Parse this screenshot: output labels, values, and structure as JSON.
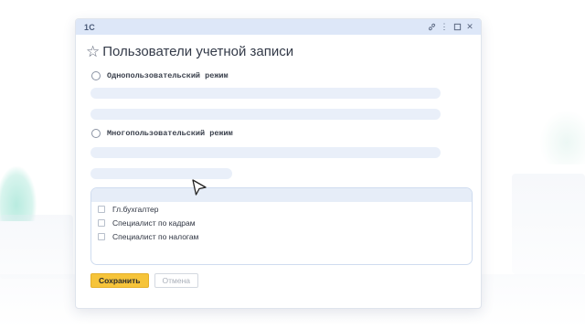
{
  "window": {
    "app_label": "1С",
    "title": "Пользователи учетной записи",
    "titlebar_icons": [
      "link-icon",
      "more-icon",
      "maximize-icon",
      "close-icon"
    ],
    "titlebar_glyphs": {
      "more": "⋮",
      "close": "✕"
    }
  },
  "icons": {
    "star": "☆"
  },
  "options": [
    {
      "label": "Однопользовательский режим",
      "selected": false
    },
    {
      "label": "Многопользовательский режим",
      "selected": false
    }
  ],
  "user_list": {
    "items": [
      {
        "label": "Гл.бухгалтер",
        "checked": false
      },
      {
        "label": "Специалист по кадрам",
        "checked": false
      },
      {
        "label": "Специалист по налогам",
        "checked": false
      }
    ]
  },
  "buttons": {
    "save": "Сохранить",
    "cancel": "Отмена"
  },
  "colors": {
    "titlebar": "#dde7f8",
    "accent_button": "#f6c43a",
    "skeleton": "#e9eff9",
    "list_border": "#cfdcef"
  }
}
